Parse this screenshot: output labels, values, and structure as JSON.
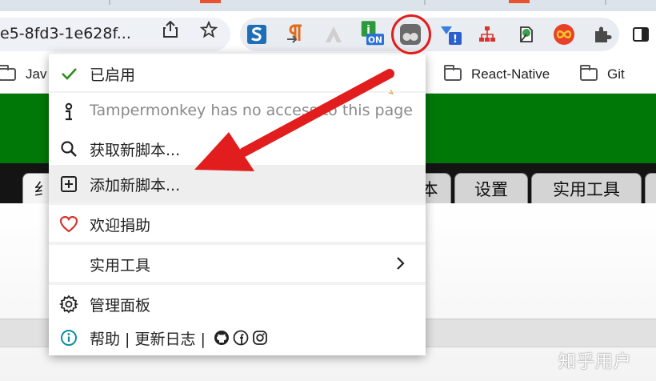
{
  "browser": {
    "url_fragment": "e5-8fd3-1e628f...",
    "extensions": [
      {
        "icon": "s-blue-icon"
      },
      {
        "icon": "pilcrow-icon"
      },
      {
        "icon": "triangle-icon"
      },
      {
        "icon": "info-on-icon",
        "badge": "ON"
      },
      {
        "icon": "tampermonkey-icon"
      },
      {
        "icon": "notify-icon"
      },
      {
        "icon": "sitemap-icon"
      },
      {
        "icon": "leaf-doc-icon"
      },
      {
        "icon": "infinity-icon"
      },
      {
        "icon": "puzzle-icon"
      },
      {
        "icon": "side-panel-icon"
      }
    ],
    "bookmarks": [
      {
        "label": "Jav"
      },
      {
        "label": "React-Native"
      },
      {
        "label": "Git"
      }
    ]
  },
  "page": {
    "tabs": [
      {
        "label": "纟"
      },
      {
        "label": "本"
      },
      {
        "label": "设置"
      },
      {
        "label": "实用工具"
      }
    ]
  },
  "menu": {
    "items": [
      {
        "icon": "checkmark-icon",
        "label": "已启用"
      },
      {
        "icon": "info-i-icon",
        "label": "Tampermonkey has no access to this page"
      },
      {
        "icon": "search-icon",
        "label": "获取新脚本..."
      },
      {
        "icon": "plus-square-icon",
        "label": "添加新脚本..."
      },
      {
        "icon": "heart-icon",
        "label": "欢迎捐助"
      },
      {
        "icon": "",
        "label": "实用工具"
      },
      {
        "icon": "gear-icon",
        "label": "管理面板"
      },
      {
        "icon": "info-circle-icon",
        "label": "帮助 | 更新日志 |"
      }
    ]
  },
  "watermark": "知乎用户",
  "colors": {
    "page_header_green": "#007808",
    "annotation_red": "#e21d1d",
    "enabled_check": "#2e8b1e",
    "heart": "#d8332c",
    "help_info": "#0a8fa0"
  }
}
